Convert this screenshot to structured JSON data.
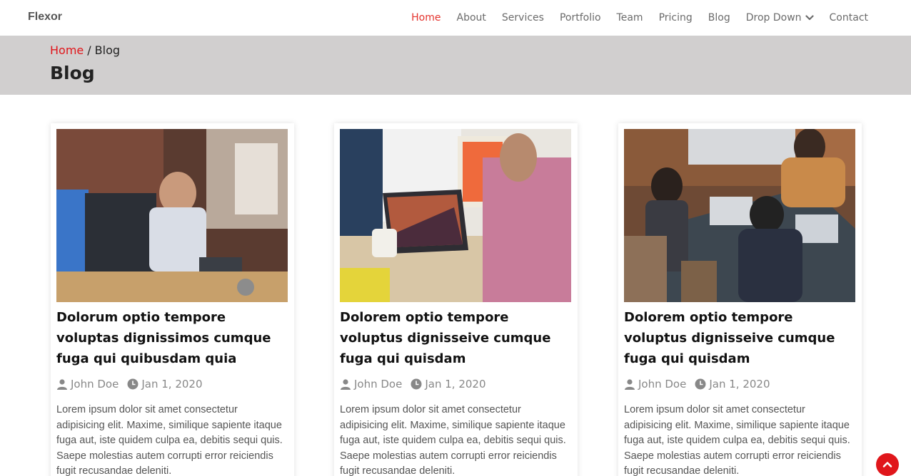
{
  "header": {
    "logo": "Flexor",
    "nav": [
      {
        "label": "Home"
      },
      {
        "label": "About"
      },
      {
        "label": "Services"
      },
      {
        "label": "Portfolio"
      },
      {
        "label": "Team"
      },
      {
        "label": "Pricing"
      },
      {
        "label": "Blog"
      },
      {
        "label": "Drop Down"
      },
      {
        "label": "Contact"
      }
    ]
  },
  "breadcrumb": {
    "home": "Home",
    "separator": "/",
    "current": "Blog",
    "page_title": "Blog"
  },
  "posts": [
    {
      "title": "Dolorum optio tempore voluptas dignissimos cumque fuga qui quibusdam quia",
      "author": "John Doe",
      "date": "Jan 1, 2020",
      "excerpt": "Lorem ipsum dolor sit amet consectetur adipisicing elit. Maxime, similique sapiente itaque fuga aut, iste quidem culpa ea, debitis sequi quis. Saepe molestias autem corrupti error reiciendis fugit recusandae deleniti."
    },
    {
      "title": "Dolorem optio tempore voluptus dignisseive cumque fuga qui quisdam",
      "author": "John Doe",
      "date": "Jan 1, 2020",
      "excerpt": "Lorem ipsum dolor sit amet consectetur adipisicing elit. Maxime, similique sapiente itaque fuga aut, iste quidem culpa ea, debitis sequi quis. Saepe molestias autem corrupti error reiciendis fugit recusandae deleniti."
    },
    {
      "title": "Dolorem optio tempore voluptus dignisseive cumque fuga qui quisdam",
      "author": "John Doe",
      "date": "Jan 1, 2020",
      "excerpt": "Lorem ipsum dolor sit amet consectetur adipisicing elit. Maxime, similique sapiente itaque fuga aut, iste quidem culpa ea, debitis sequi quis. Saepe molestias autem corrupti error reiciendis fugit recusandae deleniti."
    }
  ],
  "colors": {
    "accent": "#e0161b",
    "nav_active": "#e4322c",
    "breadcrumb_bg": "#d1cfcf"
  },
  "icons": {
    "dropdown": "chevron-down-icon",
    "author": "user-icon",
    "date": "clock-icon",
    "back_to_top": "chevron-up-icon"
  }
}
